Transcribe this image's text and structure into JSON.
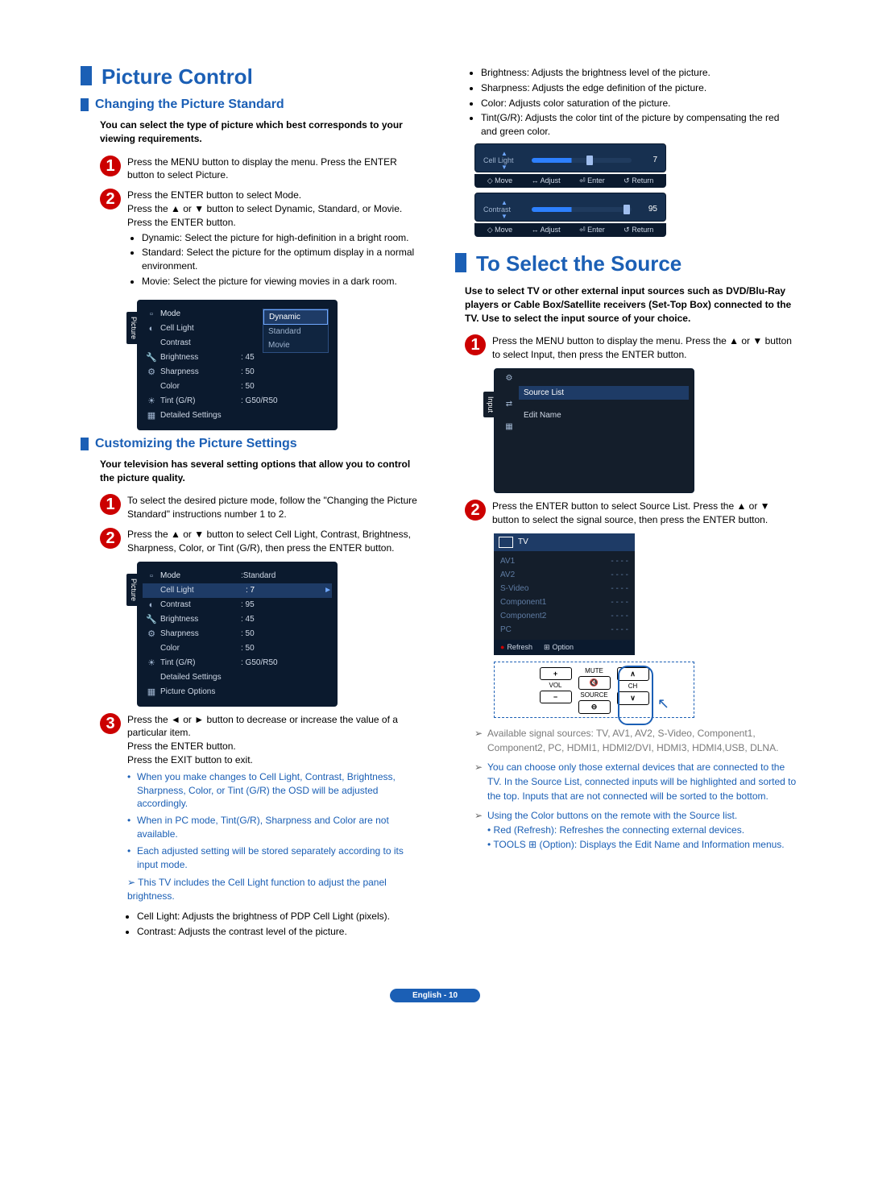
{
  "left": {
    "h1": "Picture Control",
    "section1": {
      "title": "Changing the Picture Standard",
      "intro": "You can select the type of picture which best corresponds to your viewing requirements.",
      "step1": "Press the MENU button to display the menu. Press the ENTER button to select Picture.",
      "step2_a": "Press the ENTER button to select Mode.",
      "step2_b": "Press the ▲ or ▼ button to select Dynamic, Standard, or Movie.",
      "step2_c": "Press the ENTER button.",
      "modes": {
        "dynamic": "Dynamic: Select the picture for high-definition in a bright room.",
        "standard": "Standard: Select the picture for the optimum display in a normal environment.",
        "movie": "Movie: Select the picture for viewing movies in a dark room."
      },
      "osd": {
        "side": "Picture",
        "rows": [
          {
            "icon": "▫",
            "label": "Mode",
            "value": ""
          },
          {
            "icon": "◐",
            "label": "Cell Light",
            "value": ""
          },
          {
            "icon": "",
            "label": "Contrast",
            "value": ""
          },
          {
            "icon": "🔧",
            "label": "Brightness",
            "value": ": 45"
          },
          {
            "icon": "⚙",
            "label": "Sharpness",
            "value": ": 50"
          },
          {
            "icon": "",
            "label": "Color",
            "value": ": 50"
          },
          {
            "icon": "☀",
            "label": "Tint (G/R)",
            "value": ": G50/R50"
          },
          {
            "icon": "▦",
            "label": "Detailed Settings",
            "value": ""
          }
        ],
        "dd": [
          "Dynamic",
          "Standard",
          "Movie"
        ]
      }
    },
    "section2": {
      "title": "Customizing the Picture Settings",
      "intro": "Your television has several setting options that allow you to control the picture quality.",
      "step1": "To select the desired picture mode, follow the \"Changing the Picture Standard\" instructions number 1 to 2.",
      "step2": "Press the ▲ or ▼ button to select Cell Light, Contrast, Brightness, Sharpness, Color, or Tint (G/R), then press the ENTER button.",
      "osd": {
        "side": "Picture",
        "rows": [
          {
            "icon": "▫",
            "label": "Mode",
            "value": ":Standard"
          },
          {
            "icon": "",
            "label": "Cell Light",
            "value": ": 7",
            "sel": true
          },
          {
            "icon": "◐",
            "label": "Contrast",
            "value": ": 95"
          },
          {
            "icon": "🔧",
            "label": "Brightness",
            "value": ": 45"
          },
          {
            "icon": "⚙",
            "label": "Sharpness",
            "value": ": 50"
          },
          {
            "icon": "",
            "label": "Color",
            "value": ": 50"
          },
          {
            "icon": "☀",
            "label": "Tint (G/R)",
            "value": ": G50/R50"
          },
          {
            "icon": "",
            "label": "Detailed Settings",
            "value": ""
          },
          {
            "icon": "▦",
            "label": "Picture Options",
            "value": ""
          }
        ]
      },
      "step3_a": "Press the ◄ or ► button to decrease or increase the value of a particular item.",
      "step3_b": "Press the ENTER button.",
      "step3_c": "Press the EXIT button to exit.",
      "notes": [
        "When you make changes to Cell Light, Contrast, Brightness, Sharpness, Color, or Tint (G/R) the OSD will be adjusted accordingly.",
        "When in PC mode, Tint(G/R), Sharpness and Color are not available.",
        "Each adjusted setting will be stored separately according to its input mode.",
        "This TV includes the Cell Light function to adjust the panel brightness."
      ],
      "def_cell": "Cell Light: Adjusts the brightness of PDP Cell Light (pixels).",
      "def_contrast": "Contrast: Adjusts the contrast level of the picture."
    }
  },
  "right": {
    "defs": {
      "bright": "Brightness: Adjusts the brightness level of the picture.",
      "sharp": "Sharpness: Adjusts the edge definition of the picture.",
      "color": "Color: Adjusts color saturation of the picture.",
      "tint": "Tint(G/R): Adjusts the color tint of the picture by compensating the red and green color."
    },
    "slider1": {
      "name": "Cell Light",
      "val": "7"
    },
    "slider2": {
      "name": "Contrast",
      "val": "95"
    },
    "hints": {
      "m": "◇ Move",
      "a": "↔ Adjust",
      "e": "⏎ Enter",
      "r": "↺ Return"
    },
    "h1": "To Select the Source",
    "intro": "Use to select TV or other external input sources such as DVD/Blu-Ray players or Cable Box/Satellite receivers (Set-Top Box) connected to the TV. Use to select the input source of your choice.",
    "step1": "Press the MENU button to display the menu. Press the ▲ or ▼ button to select Input, then press the ENTER button.",
    "osd_input": {
      "side": "Input",
      "icons": [
        "⚙",
        "⇄",
        "▦"
      ],
      "source_list": "Source List",
      "edit_name": "Edit Name"
    },
    "step2": "Press the ENTER button to select Source List. Press the ▲ or ▼ button to select the signal source, then press the ENTER button.",
    "osd_source": {
      "title": "TV",
      "items": [
        {
          "n": "AV1",
          "v": "- - - -"
        },
        {
          "n": "AV2",
          "v": "- - - -"
        },
        {
          "n": "S-Video",
          "v": "- - - -"
        },
        {
          "n": "Component1",
          "v": "- - - -"
        },
        {
          "n": "Component2",
          "v": "- - - -"
        },
        {
          "n": "PC",
          "v": "- - - -"
        }
      ],
      "f_refresh": "Refresh",
      "f_option": "Option"
    },
    "remote": {
      "mute": "MUTE",
      "vol": "VOL",
      "source": "SOURCE",
      "ch": "CH"
    },
    "note1": "Available signal sources: TV, AV1, AV2, S-Video, Component1, Component2, PC, HDMI1, HDMI2/DVI, HDMI3, HDMI4,USB, DLNA.",
    "note2": "You can choose only those external devices that are connected to the TV. In the Source List, connected inputs will be highlighted and sorted to the top. Inputs that are not connected will be sorted to the bottom.",
    "note3_a": "Using the Color buttons on the remote with the Source list.",
    "note3_b": "• Red (Refresh): Refreshes the connecting external devices.",
    "note3_c": "• TOOLS ⊞ (Option): Displays the Edit Name and Information menus."
  },
  "footer": "English - 10"
}
